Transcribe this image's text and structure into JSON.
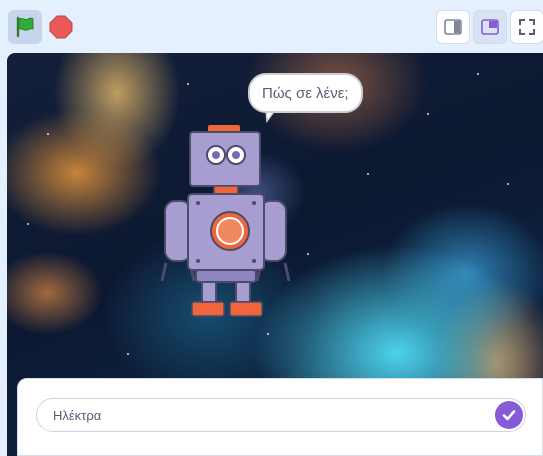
{
  "toolbar": {
    "flag_icon": "green-flag-icon",
    "stop_icon": "stop-icon",
    "small_stage_icon": "small-stage-icon",
    "large_stage_icon": "large-stage-icon",
    "fullscreen_icon": "fullscreen-icon",
    "flag_color": "#2cae3a",
    "stop_color": "#ec5959"
  },
  "stage": {
    "speech_bubble": "Πώς σε λένε;"
  },
  "answer": {
    "value": "Ηλέκτρα",
    "submit_icon": "check-icon",
    "accent": "#855cd6"
  }
}
